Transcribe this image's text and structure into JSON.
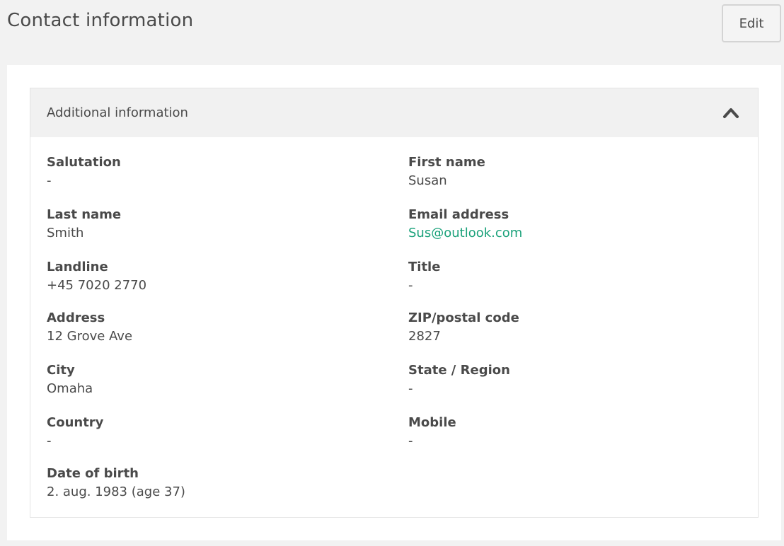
{
  "header": {
    "title": "Contact information",
    "edit_label": "Edit"
  },
  "section": {
    "title": "Additional information",
    "collapse_icon": "chevron-up-icon"
  },
  "fields": {
    "salutation": {
      "label": "Salutation",
      "value": "-"
    },
    "first_name": {
      "label": "First name",
      "value": "Susan"
    },
    "last_name": {
      "label": "Last name",
      "value": "Smith"
    },
    "email": {
      "label": "Email address",
      "value": "Sus@outlook.com"
    },
    "landline": {
      "label": "Landline",
      "value": "+45 7020 2770"
    },
    "title": {
      "label": "Title",
      "value": "-"
    },
    "address": {
      "label": "Address",
      "value": "12 Grove Ave"
    },
    "zip": {
      "label": "ZIP/postal code",
      "value": "2827"
    },
    "city": {
      "label": "City",
      "value": "Omaha"
    },
    "state": {
      "label": "State / Region",
      "value": "-"
    },
    "country": {
      "label": "Country",
      "value": "-"
    },
    "mobile": {
      "label": "Mobile",
      "value": "-"
    },
    "date_of_birth": {
      "label": "Date of birth",
      "value": "2. aug. 1983 (age 37)"
    }
  },
  "colors": {
    "link": "#1aa17a",
    "text": "#4a4a4a",
    "page_background": "#f2f2f2",
    "section_header_background": "#f1f1f1"
  }
}
